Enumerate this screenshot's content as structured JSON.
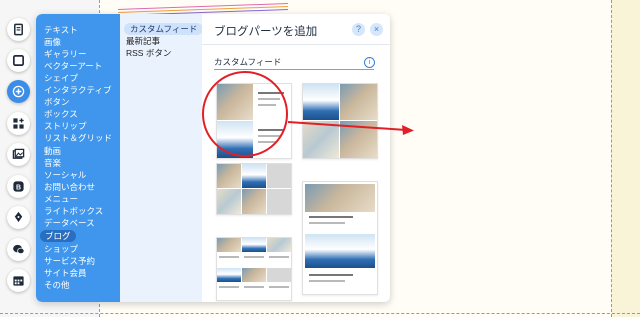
{
  "toolbar": {
    "buttons": [
      {
        "name": "pages",
        "icon": "document-icon"
      },
      {
        "name": "background",
        "icon": "square-icon"
      },
      {
        "name": "add",
        "icon": "plus-icon",
        "active": true
      },
      {
        "name": "apps",
        "icon": "apps-icon"
      },
      {
        "name": "media",
        "icon": "media-icon"
      },
      {
        "name": "blog",
        "icon": "blog-icon"
      },
      {
        "name": "design",
        "icon": "pen-icon"
      },
      {
        "name": "chat",
        "icon": "chat-icon"
      },
      {
        "name": "events",
        "icon": "calendar-icon"
      }
    ]
  },
  "categories": [
    "テキスト",
    "画像",
    "ギャラリー",
    "ベクターアート",
    "シェイプ",
    "インタラクティブ",
    "ボタン",
    "ボックス",
    "ストリップ",
    "リスト＆グリッド",
    "動画",
    "音楽",
    "ソーシャル",
    "お問い合わせ",
    "メニュー",
    "ライトボックス",
    "データベース",
    "ブログ",
    "ショップ",
    "サービス予約",
    "サイト会員",
    "その他"
  ],
  "categories_selected": "ブログ",
  "subcategories": [
    "カスタムフィード",
    "最新記事",
    "RSS ボタン"
  ],
  "subcategories_selected": "カスタムフィード",
  "panel": {
    "title": "ブログパーツを追加",
    "help_label": "?",
    "close_label": "×",
    "section_label": "カスタムフィード",
    "info_label": "i"
  },
  "colors": {
    "accent": "#3f96ec",
    "annotation": "#e21f26"
  }
}
